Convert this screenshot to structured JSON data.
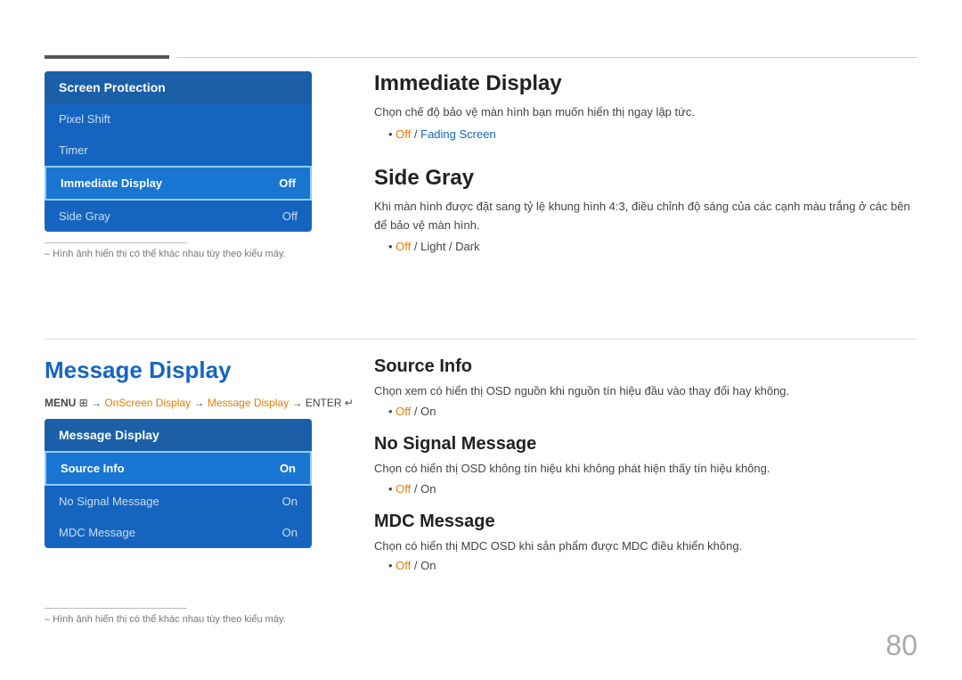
{
  "top": {
    "section1_title": "Immediate Display",
    "section1_desc": "Chọn chế độ bảo vệ màn hình bạn muốn hiển thị ngay lập tức.",
    "section1_bullet": "Off / Fading Screen",
    "section2_title": "Side Gray",
    "section2_desc": "Khi màn hình được đặt sang tỷ lệ khung hình 4:3, điều chỉnh độ sáng của các cạnh màu trắng ở các bên để bảo vệ màn hình.",
    "section2_bullet": "Off / Light / Dark"
  },
  "menu_screen_protection": {
    "header": "Screen Protection",
    "items": [
      {
        "label": "Pixel Shift",
        "value": ""
      },
      {
        "label": "Timer",
        "value": ""
      },
      {
        "label": "Immediate Display",
        "value": "Off",
        "active": true
      },
      {
        "label": "Side Gray",
        "value": "Off"
      }
    ]
  },
  "footnote": "– Hình ảnh hiển thị có thể khác nhau tùy theo kiểu máy.",
  "bottom": {
    "message_display_title": "Message Display",
    "breadcrumb_prefix": "MENU",
    "breadcrumb_menu": "III",
    "breadcrumb_arrow1": " → ",
    "breadcrumb_onscreen": "OnScreen Display",
    "breadcrumb_arrow2": " → ",
    "breadcrumb_message": "Message Display",
    "breadcrumb_arrow3": " → ENTER",
    "source_info_title": "Source Info",
    "source_info_desc": "Chọn xem có hiển thị OSD nguồn khi nguồn tín hiệu đầu vào thay đổi hay không.",
    "source_info_bullet": "Off / On",
    "no_signal_title": "No Signal Message",
    "no_signal_desc": "Chọn có hiển thị OSD không tín hiệu khi không phát hiện thấy tín hiệu không.",
    "no_signal_bullet": "Off / On",
    "mdc_title": "MDC Message",
    "mdc_desc": "Chọn có hiển thị MDC OSD khi sản phẩm được MDC điều khiển không.",
    "mdc_bullet": "Off / On"
  },
  "menu_message_display": {
    "header": "Message Display",
    "items": [
      {
        "label": "Source Info",
        "value": "On",
        "active": true
      },
      {
        "label": "No Signal Message",
        "value": "On"
      },
      {
        "label": "MDC Message",
        "value": "On"
      }
    ]
  },
  "page_number": "80"
}
